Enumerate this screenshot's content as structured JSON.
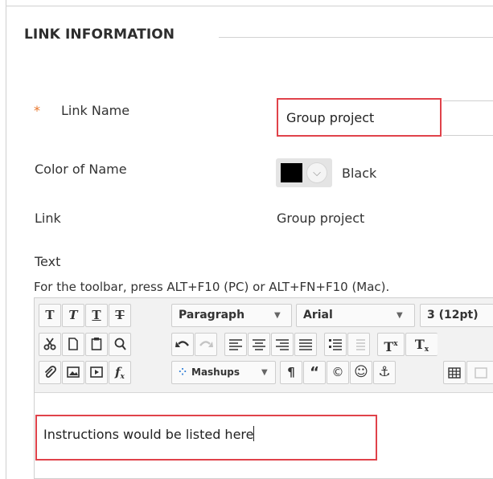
{
  "section": {
    "title": "LINK INFORMATION"
  },
  "fields": {
    "link_name": {
      "label": "Link Name",
      "required_mark": "*",
      "value": "Group project"
    },
    "color_of_name": {
      "label": "Color of Name",
      "value": "Black",
      "swatch_color": "#000000"
    },
    "link": {
      "label": "Link",
      "value": "Group project"
    },
    "text": {
      "label": "Text",
      "toolbar_hint": "For the toolbar, press ALT+F10 (PC) or ALT+FN+F10 (Mac)."
    }
  },
  "editor": {
    "toolbar_row1": {
      "format_buttons": [
        "T",
        "T",
        "T",
        "T"
      ],
      "paragraph_select": "Paragraph",
      "font_select": "Arial",
      "size_select": "3 (12pt)"
    },
    "toolbar_row2": {
      "icons": [
        "cut-icon",
        "copy-icon",
        "paste-icon",
        "find-icon",
        "undo-icon",
        "redo-icon",
        "align-left-icon",
        "align-center-icon",
        "align-right-icon",
        "align-justify-icon",
        "bullet-list-icon",
        "numbered-list-icon",
        "superscript-icon",
        "subscript-icon"
      ],
      "superscript_label": "T",
      "subscript_label": "T"
    },
    "toolbar_row3": {
      "icons": [
        "attach-icon",
        "image-icon",
        "media-icon",
        "math-formula-icon",
        "mashups-icon",
        "paragraph-mark-icon",
        "quote-icon",
        "copyright-icon",
        "emoji-icon",
        "anchor-icon",
        "table-icon"
      ],
      "mashups_label": "Mashups"
    },
    "content": "Instructions would be listed here"
  },
  "colors": {
    "highlight_border": "#e0424a",
    "required_star": "#e8762b"
  }
}
